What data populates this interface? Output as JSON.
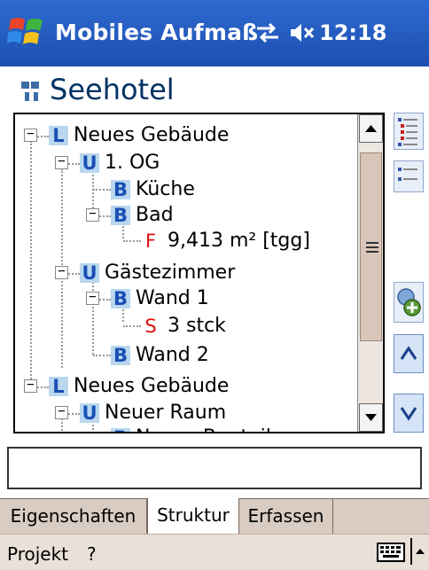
{
  "titlebar": {
    "app_title": "Mobiles Aufmaß",
    "clock": "12:18"
  },
  "project": {
    "title": "Seehotel"
  },
  "tree": {
    "nodes": [
      {
        "badge": "L",
        "label": "Neues Gebäude"
      },
      {
        "badge": "U",
        "label": "1. OG"
      },
      {
        "badge": "B",
        "label": "Küche"
      },
      {
        "badge": "B",
        "label": "Bad"
      },
      {
        "badge": "F",
        "label": "9,413 m² [tgg]"
      },
      {
        "badge": "U",
        "label": "Gästezimmer"
      },
      {
        "badge": "B",
        "label": "Wand 1"
      },
      {
        "badge": "S",
        "label": "3 stck"
      },
      {
        "badge": "B",
        "label": "Wand 2"
      },
      {
        "badge": "L",
        "label": "Neues Gebäude"
      },
      {
        "badge": "U",
        "label": "Neuer Raum"
      },
      {
        "badge": "B",
        "label": "Neues Bauteil"
      }
    ]
  },
  "input": {
    "value": ""
  },
  "tabs": [
    "Eigenschaften",
    "Struktur",
    "Erfassen"
  ],
  "active_tab": "Struktur",
  "menu": {
    "left": "Projekt",
    "help": "?"
  },
  "colors": {
    "titlebar": "#1d4fb0",
    "badge_bg": "#b9d7ee",
    "badge_text": "#1a4fb5",
    "value_badge": "#e01010"
  }
}
